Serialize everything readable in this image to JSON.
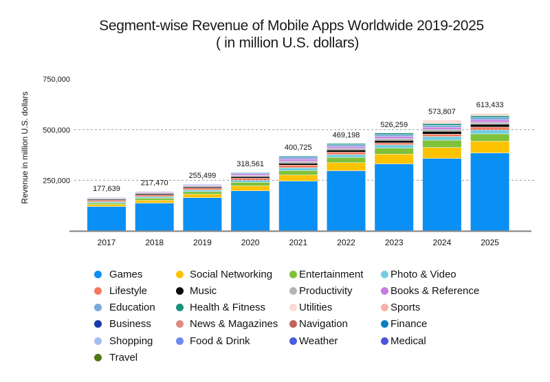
{
  "chart_data": {
    "type": "bar",
    "stacked": true,
    "title": "Segment-wise Revenue of Mobile Apps Worldwide 2019-2025",
    "subtitle": "( in million U.S. dollars)",
    "xlabel": "",
    "ylabel": "Revenue in million U.S. dollars",
    "ylim": [
      0,
      750000
    ],
    "yticks": [
      250000,
      500000,
      750000
    ],
    "ytick_labels": [
      "250,000",
      "500,000",
      "750,000"
    ],
    "gridlines_at": [
      250000,
      500000
    ],
    "grid": true,
    "legend_position": "bottom",
    "categories": [
      "2017",
      "2018",
      "2019",
      "2020",
      "2021",
      "2022",
      "2023",
      "2024",
      "2025"
    ],
    "totals": [
      177639,
      217470,
      255499,
      318561,
      400725,
      469198,
      526259,
      573807,
      613433
    ],
    "total_labels": [
      "177,639",
      "217,470",
      "255,499",
      "318,561",
      "400,725",
      "469,198",
      "526,259",
      "573,807",
      "613,433"
    ],
    "series": [
      {
        "name": "Games",
        "color": "#0a8ff5",
        "values": [
          119000,
          136000,
          163000,
          197000,
          245000,
          296000,
          330000,
          357000,
          384000
        ]
      },
      {
        "name": "Social Networking",
        "color": "#fdc300",
        "values": [
          10000,
          14000,
          17000,
          24000,
          30000,
          40000,
          48000,
          54000,
          58000
        ]
      },
      {
        "name": "Entertainment",
        "color": "#7fc139",
        "values": [
          8000,
          11000,
          13000,
          18000,
          22000,
          26000,
          30000,
          36000,
          36000
        ]
      },
      {
        "name": "Photo & Video",
        "color": "#72cde0",
        "values": [
          6000,
          7000,
          8000,
          10000,
          14000,
          14000,
          16000,
          18000,
          20000
        ]
      },
      {
        "name": "Lifestyle",
        "color": "#f5785c",
        "values": [
          7000,
          8000,
          9000,
          10000,
          13000,
          12000,
          10000,
          12000,
          14000
        ]
      },
      {
        "name": "Music",
        "color": "#0a0a0a",
        "values": [
          5000,
          6000,
          6000,
          8000,
          9000,
          11000,
          12000,
          14000,
          14000
        ]
      },
      {
        "name": "Productivity",
        "color": "#b4b4b4",
        "values": [
          4000,
          5000,
          5000,
          6000,
          10000,
          8000,
          9000,
          10000,
          10000
        ]
      },
      {
        "name": "Books & Reference",
        "color": "#c77de0",
        "values": [
          3000,
          4000,
          4000,
          8000,
          11000,
          9000,
          10000,
          10000,
          12000
        ]
      },
      {
        "name": "Education",
        "color": "#7ba7dc",
        "values": [
          3000,
          3000,
          4000,
          5000,
          12000,
          9000,
          10000,
          10000,
          12000
        ]
      },
      {
        "name": "Health & Fitness",
        "color": "#14937a",
        "values": [
          2000,
          2000,
          2000,
          3000,
          4000,
          6000,
          8000,
          8000,
          8000
        ]
      },
      {
        "name": "Utilities",
        "color": "#fbdad6",
        "values": [
          0,
          0,
          0,
          0,
          0,
          0,
          0,
          18000,
          12000
        ]
      }
    ],
    "legend": [
      {
        "name": "Games",
        "color": "#0a8ff5"
      },
      {
        "name": "Social Networking",
        "color": "#fdc300"
      },
      {
        "name": "Entertainment",
        "color": "#7fc139"
      },
      {
        "name": "Photo & Video",
        "color": "#72cde0"
      },
      {
        "name": "Lifestyle",
        "color": "#f5785c"
      },
      {
        "name": "Music",
        "color": "#0a0a0a"
      },
      {
        "name": "Productivity",
        "color": "#b4b4b4"
      },
      {
        "name": "Books & Reference",
        "color": "#c77de0"
      },
      {
        "name": "Education",
        "color": "#7ba7dc"
      },
      {
        "name": "Health & Fitness",
        "color": "#14937a"
      },
      {
        "name": "Utilities",
        "color": "#fbdad6"
      },
      {
        "name": "Sports",
        "color": "#f4b3a5"
      },
      {
        "name": "Business",
        "color": "#1a3aa8"
      },
      {
        "name": "News & Magazines",
        "color": "#de8b80"
      },
      {
        "name": "Navigation",
        "color": "#c3625b"
      },
      {
        "name": "Finance",
        "color": "#0a7ec2"
      },
      {
        "name": "Shopping",
        "color": "#a5bdf0"
      },
      {
        "name": "Food & Drink",
        "color": "#6d8af0"
      },
      {
        "name": "Weather",
        "color": "#4a5be0"
      },
      {
        "name": "Medical",
        "color": "#4a55dc"
      },
      {
        "name": "Travel",
        "color": "#4b7a12"
      }
    ]
  }
}
